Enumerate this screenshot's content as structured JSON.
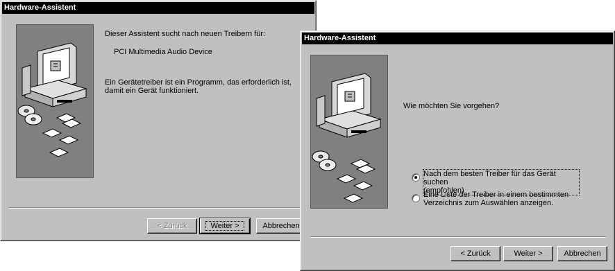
{
  "window1": {
    "title": "Hardware-Assistent",
    "intro": "Dieser Assistent sucht nach neuen Treibern für:",
    "device": "PCI Multimedia Audio Device",
    "desc_line1": "Ein Gerätetreiber ist ein Programm, das erforderlich ist,",
    "desc_line2": "damit ein Gerät funktioniert.",
    "back_label": "< Zurück",
    "next_label": "Weiter >",
    "cancel_label": "Abbrechen"
  },
  "window2": {
    "title": "Hardware-Assistent",
    "question": "Wie möchten Sie vorgehen?",
    "option1_line1": "Nach dem besten Treiber für das Gerät suchen",
    "option1_line2": "(empfohlen)",
    "option2_line1": "Eine Liste der Treiber in einem bestimmten",
    "option2_line2": "Verzeichnis zum Auswählen anzeigen.",
    "selected_option": 1,
    "back_label": "< Zurück",
    "next_label": "Weiter >",
    "cancel_label": "Abbrechen"
  },
  "colors": {
    "title_bar": "#000000",
    "dialog_bg": "#c0c0c0",
    "art_bg": "#808080"
  },
  "icons": [
    "computer-icon",
    "cd-icon",
    "floppy-disk-icon"
  ]
}
